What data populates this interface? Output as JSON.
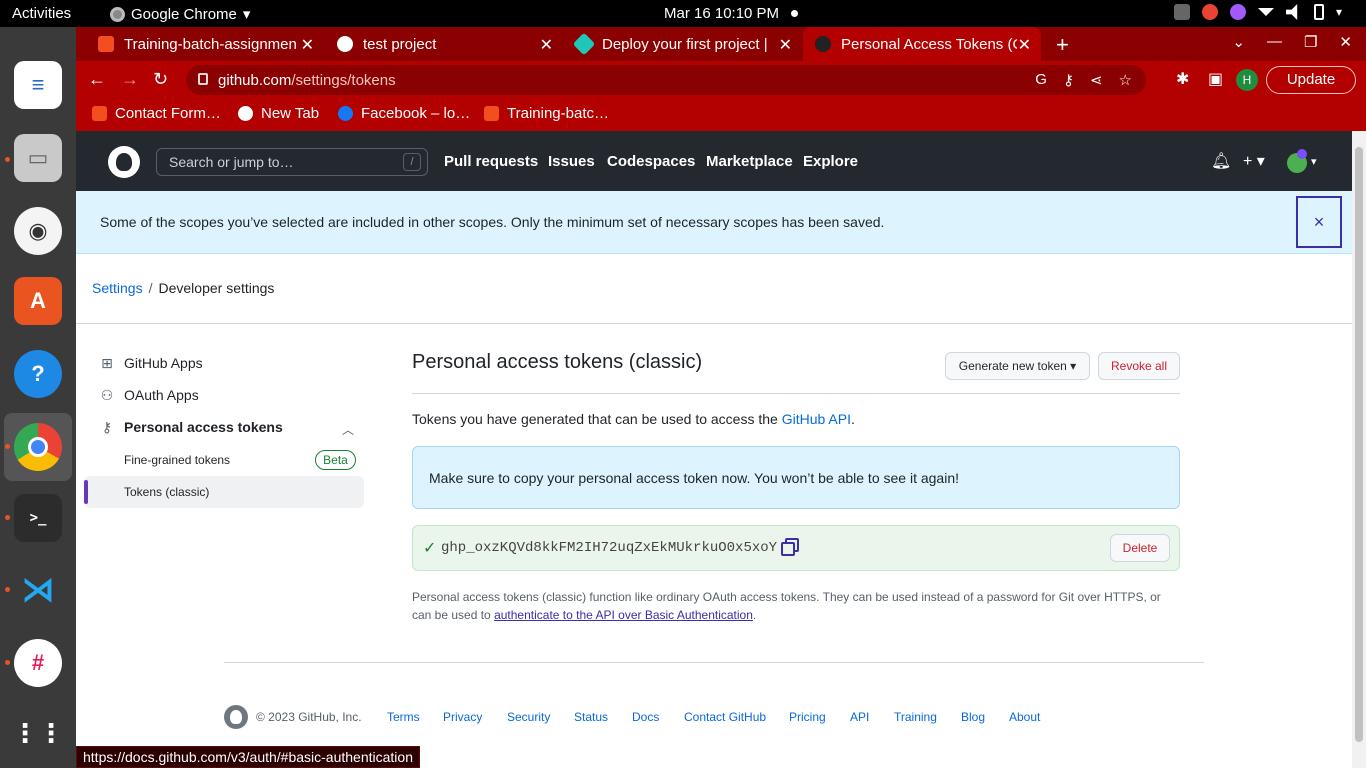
{
  "os": {
    "activities": "Activities",
    "app_name": "Google Chrome",
    "clock": "Mar 16  10:10 PM"
  },
  "browser": {
    "tabs": [
      {
        "title": "Training-batch-assignmen",
        "active": false
      },
      {
        "title": "test project",
        "active": false
      },
      {
        "title": "Deploy your first project |",
        "active": false
      },
      {
        "title": "Personal Access Tokens (C",
        "active": true
      }
    ],
    "url_host": "github.com",
    "url_path": "/settings/tokens",
    "profile_initial": "H",
    "update_label": "Update",
    "bookmarks": [
      "Contact Form…",
      "New Tab",
      "Facebook – lo…",
      "Training-batc…"
    ],
    "status_url": "https://docs.github.com/v3/auth/#basic-authentication"
  },
  "header": {
    "search_placeholder": "Search or jump to…",
    "search_shortcut": "/",
    "nav": [
      "Pull requests",
      "Issues",
      "Codespaces",
      "Marketplace",
      "Explore"
    ]
  },
  "flash": {
    "message": "Some of the scopes you’ve selected are included in other scopes. Only the minimum set of necessary scopes has been saved.",
    "close": "×"
  },
  "breadcrumb": {
    "root": "Settings",
    "separator": "/",
    "current": "Developer settings"
  },
  "sidebar": {
    "github_apps": "GitHub Apps",
    "oauth_apps": "OAuth Apps",
    "pat": "Personal access tokens",
    "fine_grained": "Fine-grained tokens",
    "beta": "Beta",
    "classic": "Tokens (classic)"
  },
  "main": {
    "title": "Personal access tokens (classic)",
    "generate_label": "Generate new token ▾",
    "revoke_label": "Revoke all",
    "intro_prefix": "Tokens you have generated that can be used to access the ",
    "intro_link": "GitHub API",
    "intro_suffix": ".",
    "notice": "Make sure to copy your personal access token now. You won’t be able to see it again!",
    "token": "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",
    "delete_label": "Delete",
    "desc_prefix": "Personal access tokens (classic) function like ordinary OAuth access tokens. They can be used instead of a password for Git over HTTPS, or can be used to ",
    "desc_link": "authenticate to the API over Basic Authentication",
    "desc_suffix": "."
  },
  "footer": {
    "copyright": "© 2023 GitHub, Inc.",
    "links": [
      "Terms",
      "Privacy",
      "Security",
      "Status",
      "Docs",
      "Contact GitHub",
      "Pricing",
      "API",
      "Training",
      "Blog",
      "About"
    ]
  }
}
